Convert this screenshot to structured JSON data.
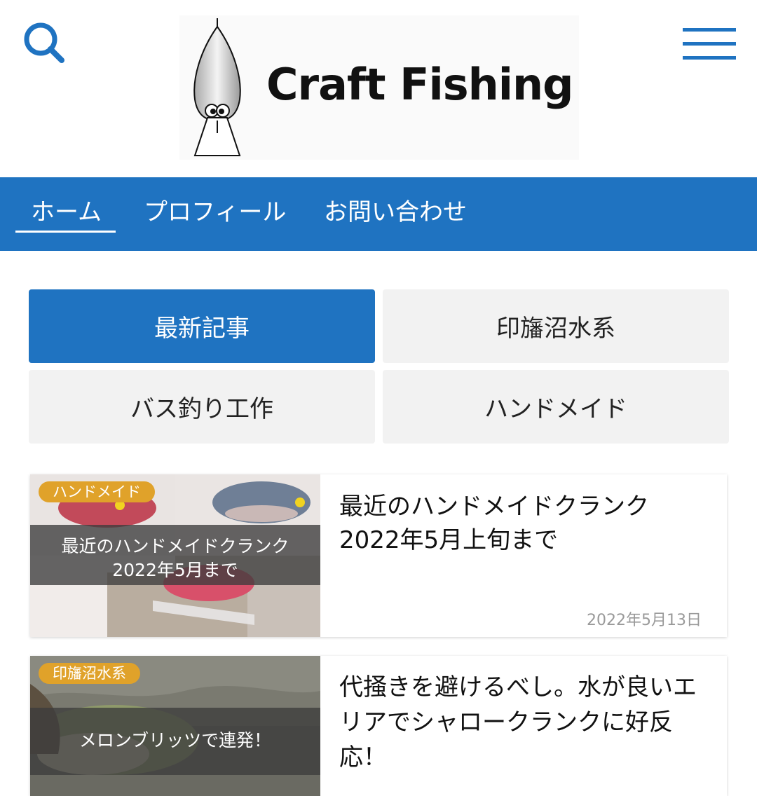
{
  "header": {
    "site_title": "Craft Fishing"
  },
  "nav": {
    "items": [
      {
        "label": "ホーム"
      },
      {
        "label": "プロフィール"
      },
      {
        "label": "お問い合わせ"
      }
    ]
  },
  "tabs": [
    {
      "label": "最新記事",
      "active": true
    },
    {
      "label": "印旛沼水系"
    },
    {
      "label": "バス釣り工作"
    },
    {
      "label": "ハンドメイド"
    }
  ],
  "articles": [
    {
      "category": "ハンドメイド",
      "thumb_caption_line1": "最近のハンドメイドクランク",
      "thumb_caption_line2": "2022年5月まで",
      "title": "最近のハンドメイドクランク2022年5月上旬まで",
      "date": "2022年5月13日"
    },
    {
      "category": "印旛沼水系",
      "thumb_caption_line1": "メロンブリッツで連発！",
      "title": "代掻きを避けるべし。水が良いエリアでシャロークランクに好反応！"
    }
  ],
  "colors": {
    "brand_blue": "#1f73c1",
    "badge_orange": "#e0a22a",
    "tab_gray": "#f2f2f2"
  },
  "icons": {
    "search": "search-icon",
    "menu": "hamburger-menu-icon"
  }
}
